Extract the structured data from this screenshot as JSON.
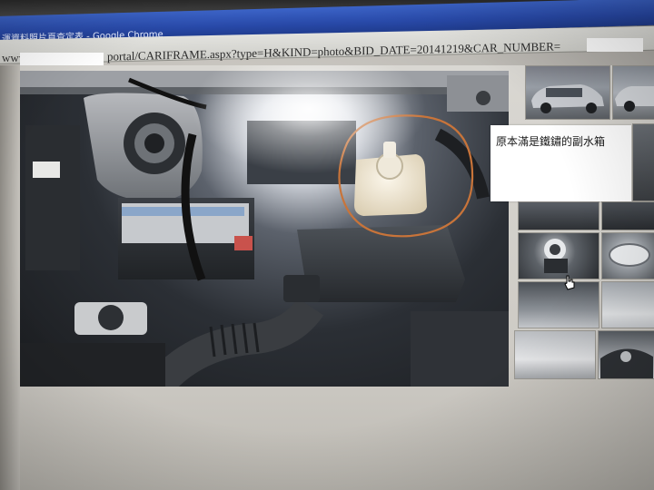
{
  "browser": {
    "window_title": "運資料照片頁查定表 - Google Chrome",
    "address_prefix": "www.",
    "address_url": "portal/CARIFRAME.aspx?type=H&KIND=photo&BID_DATE=20141219&CAR_NUMBER="
  },
  "annotation": {
    "text": "原本滿是鐵鏽的副水箱",
    "circle_color": "#c8743a"
  },
  "thumbnails": [
    {
      "name": "car-exterior-front"
    },
    {
      "name": "car-exterior-side"
    },
    {
      "name": "engine-bay-1"
    },
    {
      "name": "engine-bay-2"
    },
    {
      "name": "radiator-cap"
    },
    {
      "name": "headlight"
    },
    {
      "name": "interior-1"
    },
    {
      "name": "interior-2"
    },
    {
      "name": "floor"
    },
    {
      "name": "dashboard"
    }
  ],
  "colors": {
    "titlebar": "#2849a8",
    "page_bg": "#d9d7d2"
  }
}
